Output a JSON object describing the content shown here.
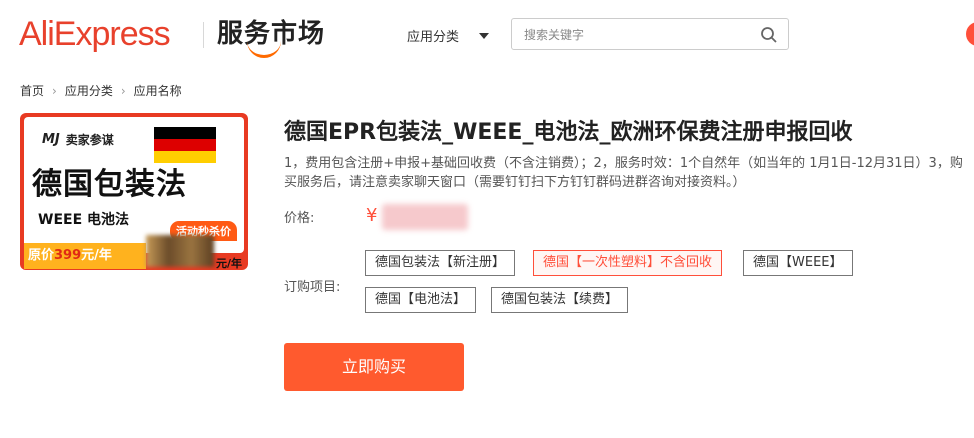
{
  "header": {
    "logo": "AliExpress",
    "market_title": "服务市场",
    "category_dropdown": "应用分类",
    "search_placeholder": "搜索关键字"
  },
  "breadcrumb": [
    "首页",
    "应用分类",
    "应用名称"
  ],
  "product_image": {
    "brand": "卖家参谋",
    "brand_mark": "MJ",
    "headline": "德国包装法",
    "subline": "WEEE 电池法",
    "promo_tag": "活动秒杀价",
    "original_price_label": "原价",
    "original_price_value": "399",
    "original_price_unit": "元/年",
    "promo_unit": "元/年",
    "flag_colors": [
      "#000000",
      "#dd0000",
      "#ffce00"
    ]
  },
  "product": {
    "title": "德国EPR包装法_WEEE_电池法_欧洲环保费注册申报回收",
    "description": "1，费用包含注册+申报+基础回收费（不含注销费）；2，服务时效：1个自然年（如当年的 1月1日-12月31日）3，购买服务后，请注意卖家聊天窗口（需要钉钉扫下方钉钉群码进群咨询对接资料。）",
    "price_label": "价格:",
    "price_symbol": "¥",
    "options_label": "订购项目:",
    "options": [
      {
        "label": "德国包装法【新注册】",
        "selected": false
      },
      {
        "label": "德国【一次性塑料】不含回收",
        "selected": true
      },
      {
        "label": "德国【WEEE】",
        "selected": false
      },
      {
        "label": "德国【电池法】",
        "selected": false
      },
      {
        "label": "德国包装法【续费】",
        "selected": false
      }
    ],
    "buy_button": "立即购买"
  },
  "colors": {
    "accent": "#ff4f3a",
    "brand": "#e8412c"
  }
}
